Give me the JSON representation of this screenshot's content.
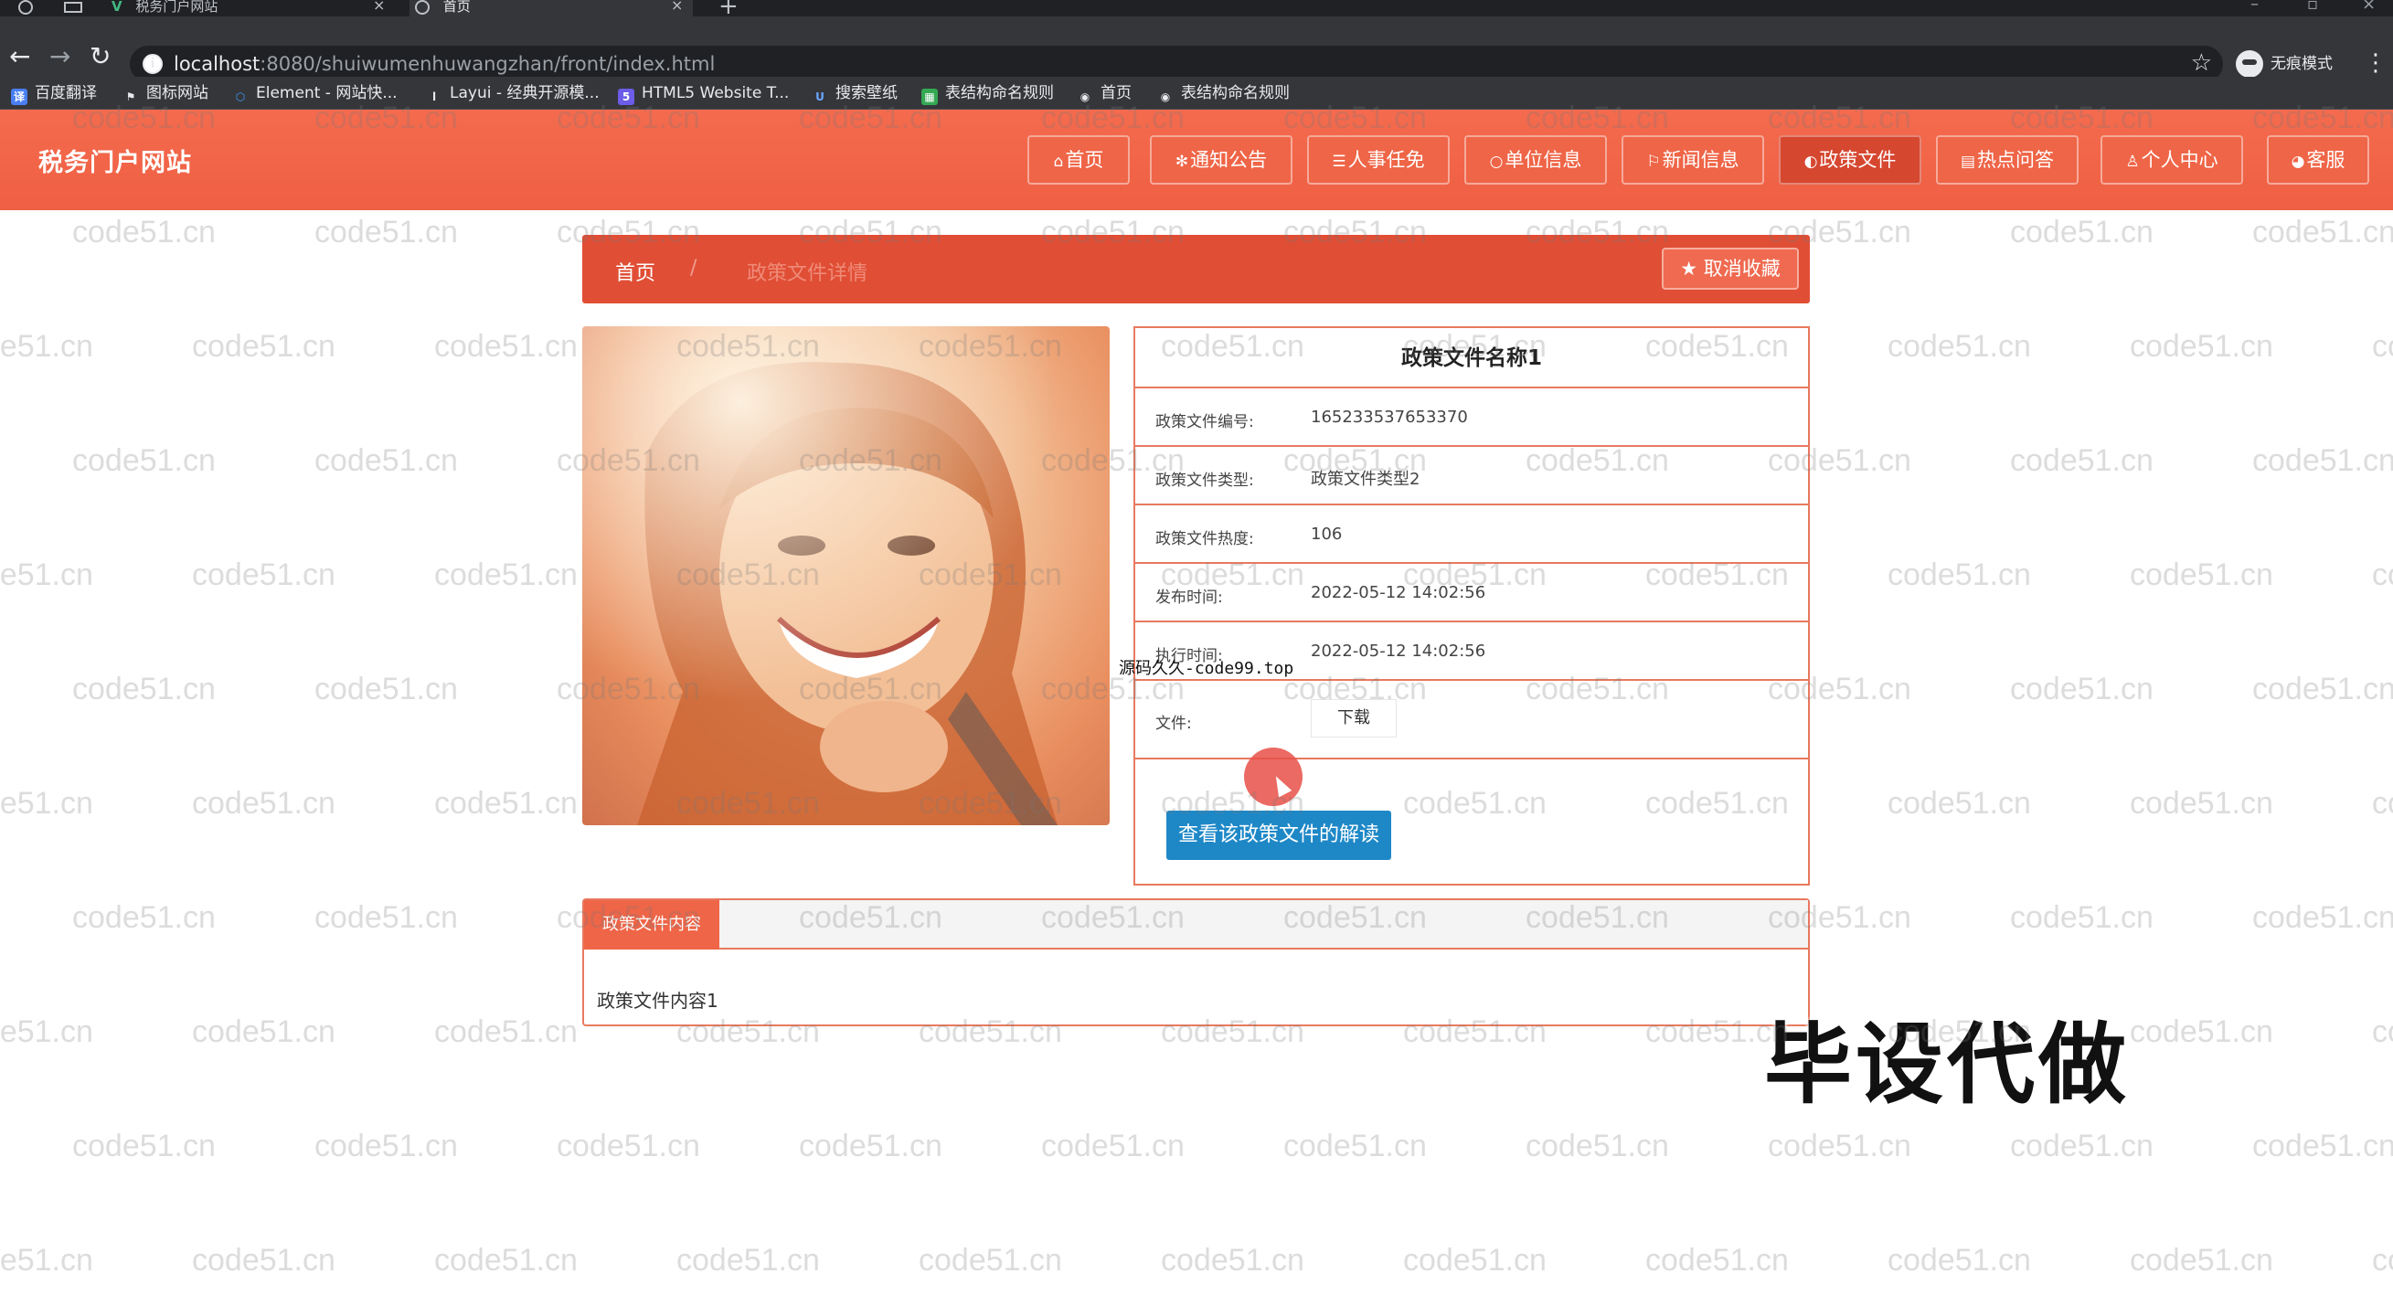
{
  "browser": {
    "tabs": [
      {
        "title": "税务门户网站",
        "active": false
      },
      {
        "title": "首页",
        "active": true
      }
    ],
    "url_host": "localhost",
    "url_rest": ":8080/shuiwumenhuwangzhan/front/index.html",
    "profile_label": "无痕模式",
    "bookmarks": [
      {
        "label": "百度翻译",
        "icon": "translate-icon",
        "color": "#4a7ff2"
      },
      {
        "label": "图标网站",
        "icon": "flag-icon",
        "color": "#5f6368"
      },
      {
        "label": "Element - 网站快...",
        "icon": "element-icon",
        "color": "#409eff"
      },
      {
        "label": "Layui - 经典开源模...",
        "icon": "layui-icon",
        "color": "#5f6368"
      },
      {
        "label": "HTML5 Website T...",
        "icon": "html5-icon",
        "color": "#6c5ce7"
      },
      {
        "label": "搜索壁纸",
        "icon": "wallpaper-icon",
        "color": "#2b6cb0"
      },
      {
        "label": "表结构命名规则",
        "icon": "table-icon",
        "color": "#34a853"
      },
      {
        "label": "首页",
        "icon": "globe-icon",
        "color": "#5f6368"
      },
      {
        "label": "表结构命名规则",
        "icon": "globe-icon",
        "color": "#5f6368"
      }
    ]
  },
  "site": {
    "title": "税务门户网站",
    "nav": [
      {
        "label": "首页",
        "icon": "home-icon",
        "glyph": "⌂",
        "active": false
      },
      {
        "label": "通知公告",
        "icon": "snowflake-icon",
        "glyph": "✻",
        "active": false
      },
      {
        "label": "人事任免",
        "icon": "layers-icon",
        "glyph": "☰",
        "active": false
      },
      {
        "label": "单位信息",
        "icon": "chat-icon",
        "glyph": "○",
        "active": false
      },
      {
        "label": "新闻信息",
        "icon": "flag-icon",
        "glyph": "⚐",
        "active": false
      },
      {
        "label": "政策文件",
        "icon": "palette-icon",
        "glyph": "◐",
        "active": true
      },
      {
        "label": "热点问答",
        "icon": "calendar-icon",
        "glyph": "▤",
        "active": false
      },
      {
        "label": "个人中心",
        "icon": "user-icon",
        "glyph": "♙",
        "active": false
      },
      {
        "label": "客服",
        "icon": "service-icon",
        "glyph": "◕",
        "active": false
      }
    ]
  },
  "breadcrumb": {
    "home": "首页",
    "separator": "/",
    "current": "政策文件详情",
    "favorite_label": "取消收藏"
  },
  "detail": {
    "name": "政策文件名称1",
    "fields": [
      {
        "key": "政策文件编号:",
        "value": "165233537653370"
      },
      {
        "key": "政策文件类型:",
        "value": "政策文件类型2"
      },
      {
        "key": "政策文件热度:",
        "value": "106"
      },
      {
        "key": "发布时间:",
        "value": "2022-05-12 14:02:56"
      },
      {
        "key": "执行时间:",
        "value": "2022-05-12 14:02:56"
      }
    ],
    "file_key": "文件:",
    "download_label": "下载",
    "interpret_label": "查看该政策文件的解读"
  },
  "content_tab": {
    "tab_label": "政策文件内容",
    "body": "政策文件内容1"
  },
  "overlays": {
    "source_tag": "源码久久-code99.top",
    "promo": "毕设代做",
    "watermark": "code51.cn"
  },
  "colors": {
    "header": "#ef5f43",
    "accent": "#e04e35",
    "button_blue": "#1e88c7"
  }
}
